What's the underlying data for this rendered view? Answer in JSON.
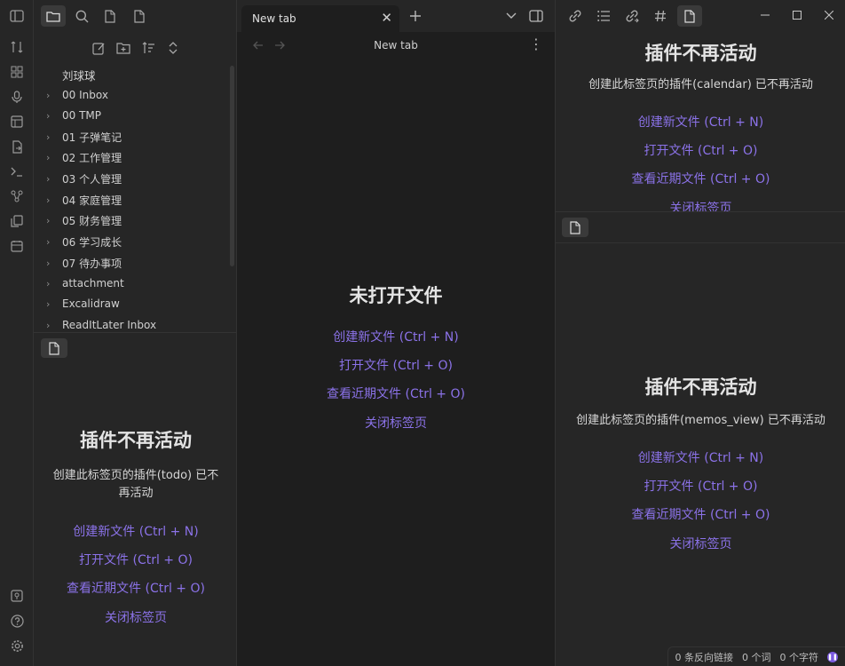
{
  "ribbon": {
    "icons": [
      "toggle-sidebar-icon",
      "folder-icon",
      "search-icon",
      "file-icon",
      "file-icon"
    ],
    "side_icons": [
      "switcher-icon",
      "blocks-icon",
      "mic-icon",
      "canvas-icon",
      "export-icon",
      "terminal-icon",
      "graph-icon",
      "copy-icon",
      "calendar-icon"
    ],
    "bottom_icons": [
      "vault-icon",
      "help-icon",
      "settings-icon"
    ]
  },
  "file_tree": {
    "vault": "刘球球",
    "items": [
      {
        "label": "00 Inbox"
      },
      {
        "label": "00 TMP"
      },
      {
        "label": "01 子弹笔记"
      },
      {
        "label": "02 工作管理"
      },
      {
        "label": "03 个人管理"
      },
      {
        "label": "04 家庭管理"
      },
      {
        "label": "05 财务管理"
      },
      {
        "label": "06 学习成长"
      },
      {
        "label": "07 待办事项"
      },
      {
        "label": "attachment"
      },
      {
        "label": "Excalidraw"
      },
      {
        "label": "ReadItLater Inbox"
      }
    ]
  },
  "left_lower": {
    "title": "插件不再活动",
    "desc": "创建此标签页的插件(todo) 已不再活动",
    "actions": [
      "创建新文件 (Ctrl + N)",
      "打开文件 (Ctrl + O)",
      "查看近期文件 (Ctrl + O)",
      "关闭标签页"
    ]
  },
  "center": {
    "tab_title": "New tab",
    "view_title": "New tab",
    "empty_title": "未打开文件",
    "actions": [
      "创建新文件 (Ctrl + N)",
      "打开文件 (Ctrl + O)",
      "查看近期文件 (Ctrl + O)",
      "关闭标签页"
    ]
  },
  "right_top": {
    "title": "插件不再活动",
    "desc": "创建此标签页的插件(calendar) 已不再活动",
    "actions": [
      "创建新文件 (Ctrl + N)",
      "打开文件 (Ctrl + O)",
      "查看近期文件 (Ctrl + O)",
      "关闭标签页"
    ]
  },
  "right_bottom": {
    "title": "插件不再活动",
    "desc": "创建此标签页的插件(memos_view) 已不再活动",
    "actions": [
      "创建新文件 (Ctrl + N)",
      "打开文件 (Ctrl + O)",
      "查看近期文件 (Ctrl + O)",
      "关闭标签页"
    ]
  },
  "status": {
    "backlinks": "0 条反向链接",
    "words": "0 个词",
    "chars": "0 个字符"
  },
  "colors": {
    "accent": "#8b72e8",
    "bg": "#1e1e1e",
    "panel": "#262626"
  }
}
